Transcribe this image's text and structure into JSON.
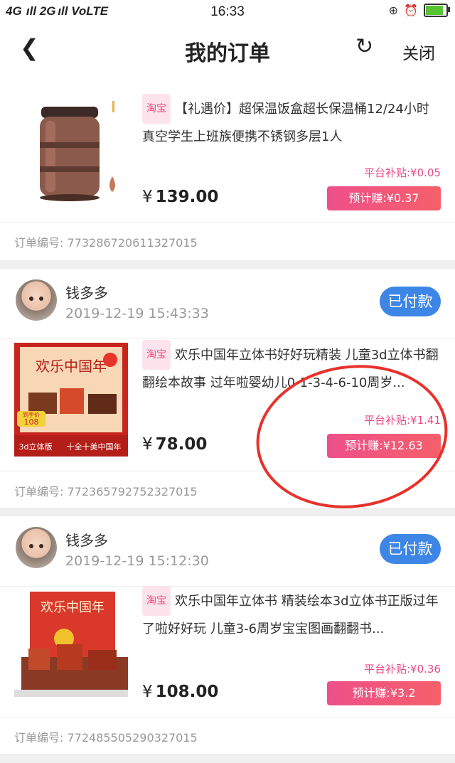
{
  "status_bar": {
    "left": "4G  ıll 2G ıll  VoLTE",
    "time": "16:33"
  },
  "nav": {
    "title": "我的订单",
    "close_label": "关闭"
  },
  "orders": [
    {
      "header": null,
      "badge": "淘宝",
      "title": "【礼遇价】超保温饭盒超长保温桶12/24小时真空学生上班族便携不锈钢多层1人",
      "subsidy": "平台补贴:¥0.05",
      "price_symbol": "¥",
      "price": "139.00",
      "earn": "预计赚:¥0.37",
      "order_no": "订单编号: 773286720611327015"
    },
    {
      "header": {
        "name": "钱多多",
        "time": "2019-12-19 15:43:33",
        "status": "已付款"
      },
      "badge": "淘宝",
      "title": "欢乐中国年立体书好好玩精装 儿童3d立体书翻翻绘本故事 过年啦婴幼儿0-1-3-4-6-10周岁...",
      "subsidy": "平台补贴:¥1.41",
      "price_symbol": "¥",
      "price": "78.00",
      "earn": "预计赚:¥12.63",
      "order_no": "订单编号: 772365792752327015",
      "image_text": {
        "top": "欢乐中国年",
        "price_tag": "到手价",
        "price_tag_value": "108",
        "bottom_left": "3d立体版",
        "bottom_right": "十全十美中国年"
      }
    },
    {
      "header": {
        "name": "钱多多",
        "time": "2019-12-19 15:12:30",
        "status": "已付款"
      },
      "badge": "淘宝",
      "title": "欢乐中国年立体书 精装绘本3d立体书正版过年了啦好好玩 儿童3-6周岁宝宝图画翻翻书...",
      "subsidy": "平台补贴:¥0.36",
      "price_symbol": "¥",
      "price": "108.00",
      "earn": "预计赚:¥3.2",
      "order_no": "订单编号: 772485505290327015",
      "image_text": {
        "top": "欢乐中国年"
      }
    }
  ],
  "colors": {
    "accent_pink": "#e94b7e",
    "paid_blue": "#3d86e6",
    "annotation_red": "#e8312a"
  }
}
